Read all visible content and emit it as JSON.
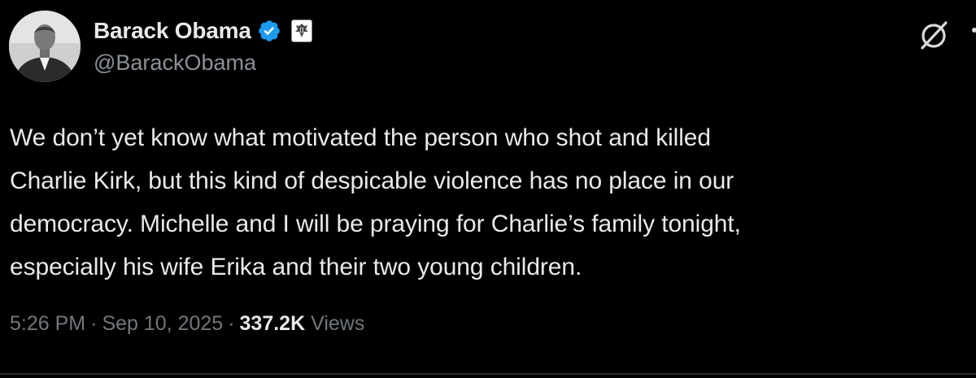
{
  "author": {
    "display_name": "Barack Obama",
    "handle": "@BarackObama",
    "verified": true
  },
  "tweet": {
    "text": "We don’t yet know what motivated the person who shot and killed\nCharlie Kirk, but this kind of despicable violence has no place in our\ndemocracy. Michelle and I will be praying for Charlie’s family tonight,\nespecially his wife Erika and their two young children."
  },
  "meta": {
    "time": "5:26 PM",
    "separator": "·",
    "date": "Sep 10, 2025",
    "views_count": "337.2K",
    "views_label": "Views"
  },
  "icons": {
    "verified": "verified-badge-icon",
    "affiliate": "government-seal-icon",
    "grok": "grok-icon",
    "more": "more-icon"
  },
  "colors": {
    "background": "#000000",
    "text_primary": "#e7e9ea",
    "text_secondary": "#71767b",
    "verified_blue": "#1d9bf0"
  }
}
